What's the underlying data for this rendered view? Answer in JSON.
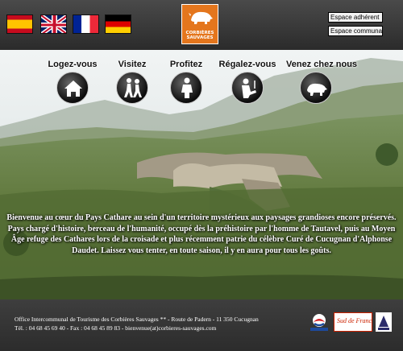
{
  "header": {
    "flags": [
      {
        "name": "spanish-flag",
        "colors": [
          "#c60b1e",
          "#ffc400"
        ]
      },
      {
        "name": "uk-flag",
        "colors": [
          "#012169",
          "#ffffff",
          "#c8102e"
        ]
      },
      {
        "name": "french-flag",
        "colors": [
          "#002395",
          "#ffffff",
          "#ed2939"
        ]
      },
      {
        "name": "german-flag",
        "colors": [
          "#000000",
          "#dd0000",
          "#ffce00"
        ]
      }
    ],
    "logo": {
      "text": "CORBIÈRES\nSAUVAGES",
      "color": "#e4761d",
      "icon": "boar-icon"
    },
    "espace_adherent": "Espace adhérent",
    "espace_communal": "Espace communal"
  },
  "nav": [
    {
      "label": "Logez-vous",
      "icon": "house-icon"
    },
    {
      "label": "Visitez",
      "icon": "hikers-icon"
    },
    {
      "label": "Profitez",
      "icon": "person-icon"
    },
    {
      "label": "Régalez-vous",
      "icon": "diner-icon"
    },
    {
      "label": "Venez chez nous",
      "icon": "boar-icon"
    }
  ],
  "intro": "Bienvenue au cœur du Pays Cathare au sein d'un territoire mystérieux aux paysages grandioses encore préservés. Pays chargé d'histoire, berceau de l'humanité, occupé dès la préhistoire par l'homme de Tautavel, puis au Moyen Âge refuge des Cathares lors de la croisade et plus récemment patrie du célèbre Curé de Cucugnan d'Alphonse Daudet. Laissez vous tenter, en toute saison, il y en aura pour tous les goûts.",
  "footer": {
    "line1": "Office Intercommunal de Tourisme des Corbières Sauvages ** - Route de Padern - 11 350 Cucugnan",
    "line2": "Tél. : 04 68 45 69 40 - Fax : 04 68 45 89 83 - bienvenue(at)corbieres-sauvages.com",
    "partners": {
      "sud_de_france": "Sud de France"
    }
  },
  "colors": {
    "accent": "#e4761d",
    "header_bg": "#333333",
    "sky": "#dfe8ea",
    "vegetation": "#6f8a4a"
  }
}
